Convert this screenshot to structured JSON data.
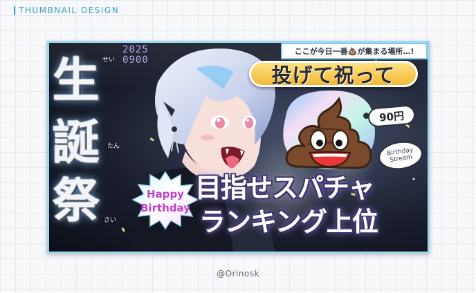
{
  "header": {
    "label": "THUMBNAIL DESIGN",
    "accent_color": "#3a9fc4"
  },
  "thumbnail": {
    "kanji": [
      "生",
      "誕",
      "祭"
    ],
    "ruby": [
      "せい",
      "たん",
      "さい"
    ],
    "date_year": "2025",
    "date_day": "0900",
    "top_banner": "ここが今日一番💩が集まる場所…!",
    "headline_top": "投げて祝って",
    "price_tag": "90円",
    "stream_badge": [
      "Birthday",
      "Stream"
    ],
    "happy_birthday": [
      "Happy",
      "Birthday"
    ],
    "headline_main_1": "目指せスパチャ",
    "headline_main_2": "ランキング上位",
    "mascot_icon": "poop-emoji-icon",
    "colors": {
      "frame": "#9bd8f5",
      "gold": "#f1b52f",
      "purple_text": "#c23fc8",
      "outline": "#3b3470"
    }
  },
  "footer": {
    "credit": "@Orinosk"
  }
}
